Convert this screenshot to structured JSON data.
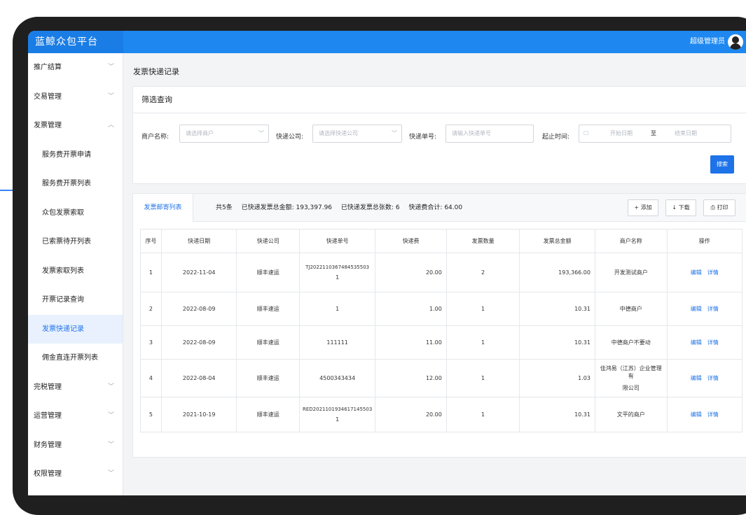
{
  "app": {
    "title": "蓝鲸众包平台",
    "admin": "超级管理员"
  },
  "sidebar": {
    "items": [
      {
        "label": "推广结算",
        "chevron": "﹀"
      },
      {
        "label": "交易管理",
        "chevron": "﹀"
      },
      {
        "label": "发票管理",
        "chevron": "︿"
      },
      {
        "label": "服务费开票申请"
      },
      {
        "label": "服务费开票列表"
      },
      {
        "label": "众包发票索取"
      },
      {
        "label": "已索票待开列表"
      },
      {
        "label": "发票索取列表"
      },
      {
        "label": "开票记录查询"
      },
      {
        "label": "发票快递记录"
      },
      {
        "label": "佣金直连开票列表"
      },
      {
        "label": "完税管理",
        "chevron": "﹀"
      },
      {
        "label": "运营管理",
        "chevron": "﹀"
      },
      {
        "label": "财务管理",
        "chevron": "﹀"
      },
      {
        "label": "权限管理",
        "chevron": "﹀"
      }
    ]
  },
  "page": {
    "title": "发票快递记录"
  },
  "filter": {
    "title": "筛选查询",
    "merchant_label": "商户名称:",
    "merchant_placeholder": "请选择商户",
    "company_label": "快递公司:",
    "company_placeholder": "请选择快递公司",
    "tracking_label": "快递单号:",
    "tracking_placeholder": "请输入快递单号",
    "date_label": "起止时间:",
    "date_start": "开始日期",
    "date_sep": "至",
    "date_end": "结束日期",
    "search_button": "搜索"
  },
  "list": {
    "tab": "发票邮寄列表",
    "total": "共5条",
    "amount": "已快递发票总金额: 193,397.96",
    "count": "已快递发票总张数: 6",
    "fee": "快递费合计: 64.00",
    "add_button": "+ 添加",
    "download_button": "↓ 下载",
    "print_button": "⎙ 打印",
    "headers": [
      "序号",
      "快递日期",
      "快递公司",
      "快递单号",
      "快递费",
      "发票数量",
      "发票总金额",
      "商户名称",
      "操作"
    ],
    "edit_label": "编辑",
    "detail_label": "详情",
    "rows": [
      {
        "no": "1",
        "date": "2022-11-04",
        "company": "顺丰速运",
        "tracking_1": "TJ2022110367484535503",
        "tracking_2": "1",
        "fee": "20.00",
        "qty": "2",
        "amount": "193,366.00",
        "merchant": "开发测试商户"
      },
      {
        "no": "2",
        "date": "2022-08-09",
        "company": "顺丰速运",
        "tracking_1": "1",
        "tracking_2": "",
        "fee": "1.00",
        "qty": "1",
        "amount": "10.31",
        "merchant": "中德商户"
      },
      {
        "no": "3",
        "date": "2022-08-09",
        "company": "顺丰速运",
        "tracking_1": "111111",
        "tracking_2": "",
        "fee": "11.00",
        "qty": "1",
        "amount": "10.31",
        "merchant": "中德商户不要动"
      },
      {
        "no": "4",
        "date": "2022-08-04",
        "company": "顺丰速运",
        "tracking_1": "4500343434",
        "tracking_2": "",
        "fee": "12.00",
        "qty": "1",
        "amount": "1.03",
        "merchant_1": "佳鸿易（江苏）企业管理有",
        "merchant_2": "限公司"
      },
      {
        "no": "5",
        "date": "2021-10-19",
        "company": "顺丰速运",
        "tracking_1": "RED2021101934617145503",
        "tracking_2": "1",
        "fee": "20.00",
        "qty": "1",
        "amount": "10.31",
        "merchant": "文平的商户"
      }
    ]
  }
}
